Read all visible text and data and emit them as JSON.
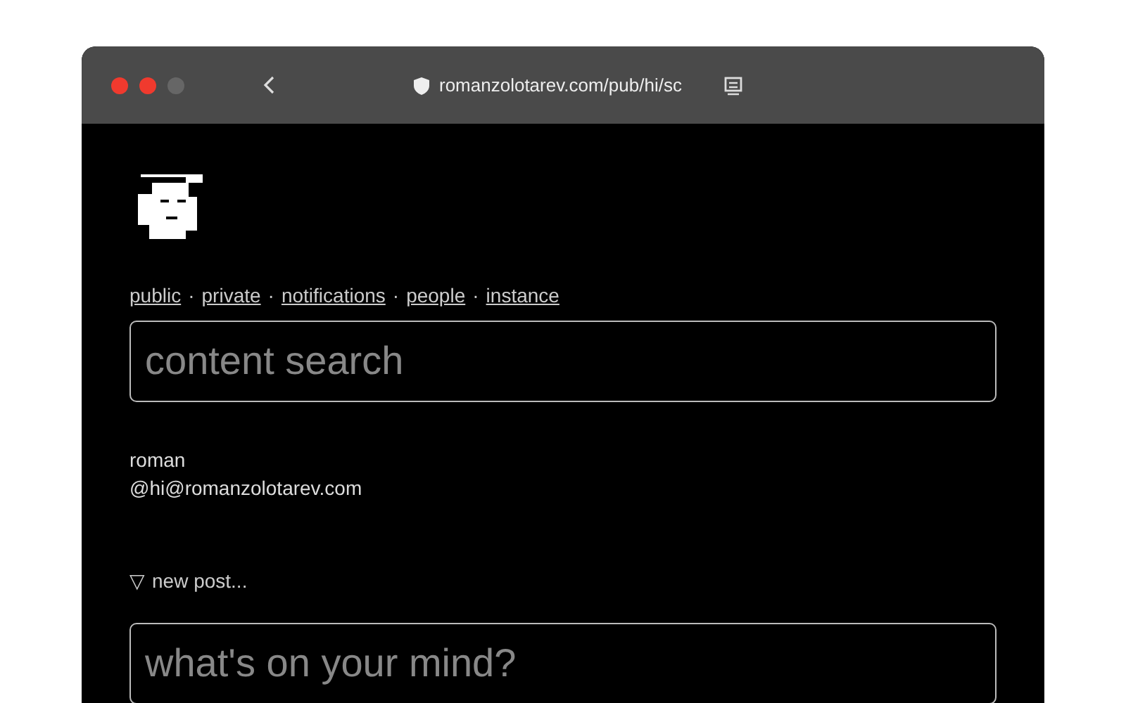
{
  "browser": {
    "url": "romanzolotarev.com/pub/hi/sc"
  },
  "nav": [
    "public",
    "private",
    "notifications",
    "people",
    "instance"
  ],
  "nav_separator": "·",
  "search": {
    "placeholder": "content search"
  },
  "profile": {
    "name": "roman",
    "handle": "@hi@romanzolotarev.com"
  },
  "new_post": {
    "marker": "▽",
    "label": "new post..."
  },
  "composer": {
    "placeholder": "what's on your mind?"
  }
}
